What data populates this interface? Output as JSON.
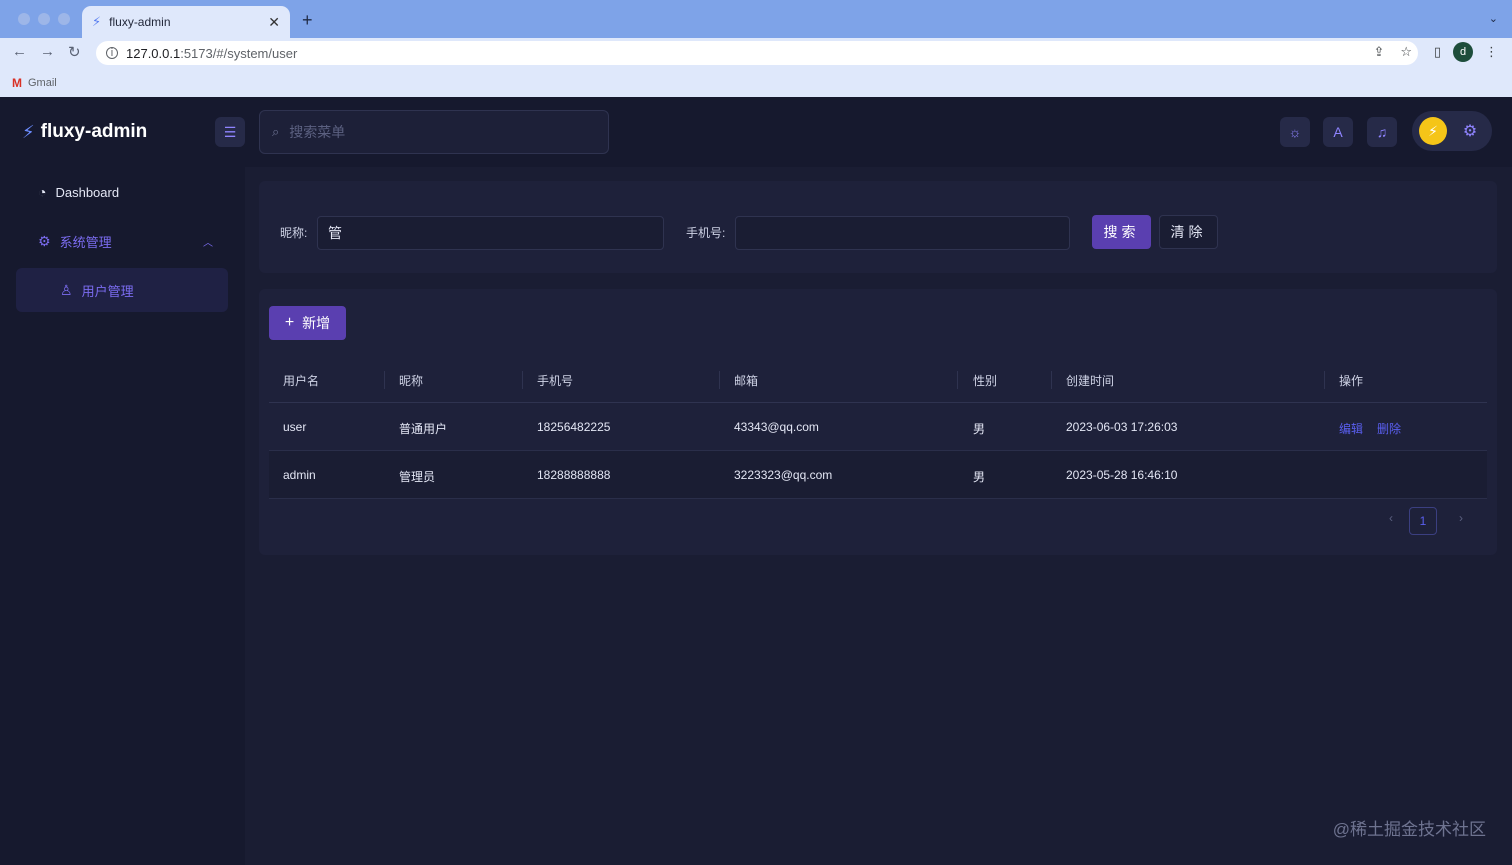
{
  "browser": {
    "tab_title": "fluxy-admin",
    "new_tab": "+",
    "url_host": "127.0.0.1",
    "url_path": ":5173/#/system/user",
    "bookmark": "Gmail",
    "profile_initial": "d"
  },
  "app": {
    "logo_text": "fluxy-admin",
    "search_placeholder": "搜索菜单"
  },
  "sidebar": {
    "items": [
      {
        "label": "Dashboard",
        "icon": "dashboard-icon"
      },
      {
        "label": "系统管理",
        "icon": "gear-icon"
      },
      {
        "label": "用户管理",
        "icon": "user-icon"
      }
    ]
  },
  "filter": {
    "nickname_label": "昵称:",
    "nickname_value": "管",
    "phone_label": "手机号:",
    "phone_value": "",
    "search_button": "搜索",
    "clear_button": "清除"
  },
  "table": {
    "add_button": "新增",
    "columns": [
      "用户名",
      "昵称",
      "手机号",
      "邮箱",
      "性别",
      "创建时间",
      "操作"
    ],
    "rows": [
      {
        "username": "user",
        "nickname": "普通用户",
        "phone": "18256482225",
        "email": "43343@qq.com",
        "gender": "男",
        "created": "2023-06-03 17:26:03",
        "actions": [
          "编辑",
          "删除"
        ]
      },
      {
        "username": "admin",
        "nickname": "管理员",
        "phone": "18288888888",
        "email": "3223323@qq.com",
        "gender": "男",
        "created": "2023-05-28 16:46:10",
        "actions": []
      }
    ],
    "page_current": "1",
    "prev": "‹",
    "next": "›"
  },
  "watermark": "@稀土掘金技术社区",
  "colors": {
    "accent": "#5a3fb0",
    "link": "#5a5ff0",
    "menu_active": "#7b6cf0"
  }
}
